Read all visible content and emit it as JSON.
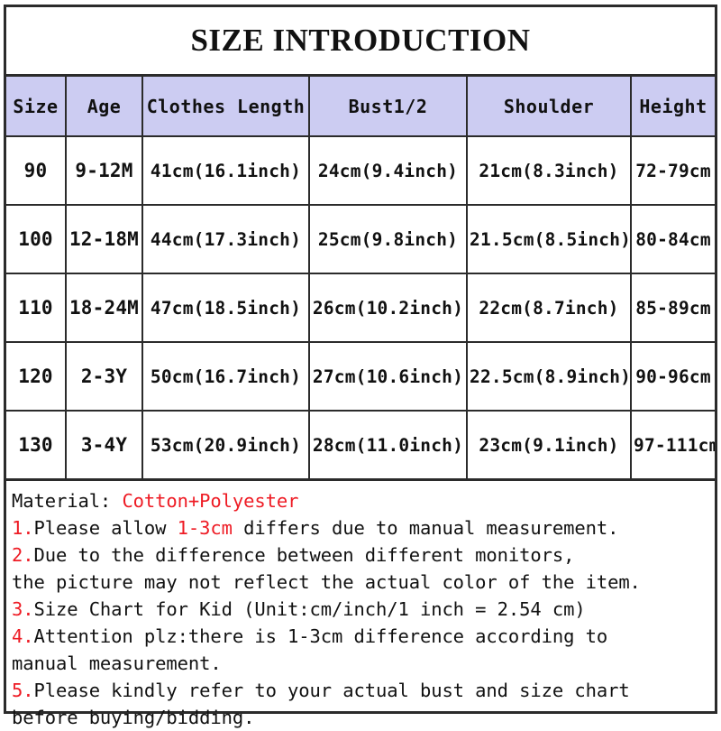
{
  "title": "SIZE INTRODUCTION",
  "colors": {
    "header_background": "#ccccf2",
    "border": "#2b2b2b",
    "accent_red": "#ee1b24",
    "text": "#111111",
    "page_background": "#ffffff"
  },
  "table": {
    "columns": [
      "Size",
      "Age",
      "Clothes Length",
      "Bust1/2",
      "Shoulder",
      "Height"
    ],
    "rows": [
      {
        "size": "90",
        "age": "9-12M",
        "clothes_length": "41cm(16.1inch)",
        "bust": "24cm(9.4inch)",
        "shoulder": "21cm(8.3inch)",
        "height": "72-79cm"
      },
      {
        "size": "100",
        "age": "12-18M",
        "clothes_length": "44cm(17.3inch)",
        "bust": "25cm(9.8inch)",
        "shoulder": "21.5cm(8.5inch)",
        "height": "80-84cm"
      },
      {
        "size": "110",
        "age": "18-24M",
        "clothes_length": "47cm(18.5inch)",
        "bust": "26cm(10.2inch)",
        "shoulder": "22cm(8.7inch)",
        "height": "85-89cm"
      },
      {
        "size": "120",
        "age": "2-3Y",
        "clothes_length": "50cm(16.7inch)",
        "bust": "27cm(10.6inch)",
        "shoulder": "22.5cm(8.9inch)",
        "height": "90-96cm"
      },
      {
        "size": "130",
        "age": "3-4Y",
        "clothes_length": "53cm(20.9inch)",
        "bust": "28cm(11.0inch)",
        "shoulder": "23cm(9.1inch)",
        "height": "97-111cm"
      }
    ]
  },
  "material": {
    "label": "Material:",
    "value": "Cotton+Polyester"
  },
  "notes": {
    "n1": {
      "num": "1.",
      "pre": "Please allow ",
      "highlight": "1-3cm",
      "post": " differs due to manual measurement."
    },
    "n2": {
      "num": "2.",
      "line1": "Due to the difference between different monitors,",
      "line2": "the picture may not reflect the actual color of the item."
    },
    "n3": {
      "num": "3.",
      "line1": "Size Chart for Kid (Unit:cm/inch/1 inch = 2.54 cm)"
    },
    "n4": {
      "num": "4.",
      "line1": "Attention plz:there is 1-3cm difference according to",
      "line2": "manual measurement."
    },
    "n5": {
      "num": "5.",
      "line1": "Please kindly refer to your actual bust and size chart",
      "line2": "before buying/bidding."
    }
  }
}
